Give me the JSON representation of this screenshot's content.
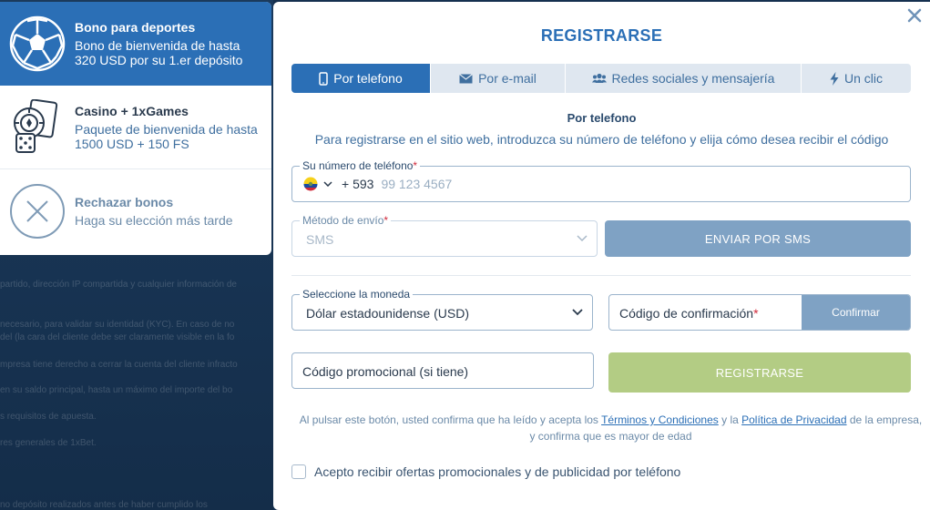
{
  "background": {
    "lines": [
      "partido, dirección IP compartida y cualquier información de",
      "necesario, para validar su identidad (KYC). En caso de no",
      "del (la cara del cliente debe ser claramente visible en la fo",
      "mpresa tiene derecho a cerrar la cuenta del cliente infracto",
      "en su saldo principal, hasta un máximo del importe del bo",
      "s requisitos de apuesta.",
      "res generales de 1xBet.",
      "no depósito realizados antes de haber cumplido los"
    ]
  },
  "bonuses": [
    {
      "title": "Bono para deportes",
      "desc1": "Bono de bienvenida de hasta",
      "desc2": "320 USD por su 1.er depósito",
      "icon": "soccer-ball-icon",
      "active": true
    },
    {
      "title": "Casino + 1xGames",
      "desc1": "Paquete de bienvenida de hasta",
      "desc2": "1500 USD + 150 FS",
      "icon": "casino-chips-cards-icon",
      "active": false
    },
    {
      "title": "Rechazar bonos",
      "desc1": "Haga su elección más tarde",
      "desc2": "",
      "icon": "close-circle-icon",
      "active": false
    }
  ],
  "modal": {
    "title": "REGISTRARSE",
    "tabs": [
      {
        "label": "Por telefono",
        "icon": "phone-icon",
        "active": true
      },
      {
        "label": "Por e-mail",
        "icon": "envelope-icon",
        "active": false
      },
      {
        "label": "Redes sociales y mensajería",
        "icon": "users-icon",
        "active": false
      },
      {
        "label": "Un clic",
        "icon": "lightning-icon",
        "active": false
      }
    ],
    "section_title": "Por telefono",
    "section_desc": "Para registrarse en el sitio web, introduzca su número de teléfono y elija cómo desea recibir el código",
    "phone": {
      "label": "Su número de teléfono",
      "required": "*",
      "dial_code": "+ 593",
      "placeholder": "99 123 4567",
      "flag": "ecuador-flag"
    },
    "method": {
      "label": "Método de envío",
      "required": "*",
      "value": "SMS"
    },
    "send_button": "ENVIAR POR SMS",
    "currency": {
      "label": "Seleccione la moneda",
      "value": "Dólar estadounidense (USD)"
    },
    "code": {
      "placeholder": "Código de confirmación",
      "required": "*",
      "confirm_button": "Confirmar"
    },
    "promo": {
      "placeholder": "Código promocional (si tiene)"
    },
    "register_button": "REGISTRARSE",
    "legal": {
      "part1": "Al pulsar este botón, usted confirma que ha leído y acepta los ",
      "terms_link": "Términos y Condiciones",
      "part2": " y la ",
      "privacy_link": "Política de Privacidad",
      "part3": " de la empresa,",
      "line2": "y confirma que es mayor de edad"
    },
    "consent": "Acepto recibir ofertas promocionales y de publicidad por teléfono"
  },
  "colors": {
    "primary": "#2b6fb6",
    "tab_bg": "#dfe7f0",
    "sms_button": "#7fa2c4",
    "register_button": "#b3cc84",
    "required": "#d0293a"
  }
}
